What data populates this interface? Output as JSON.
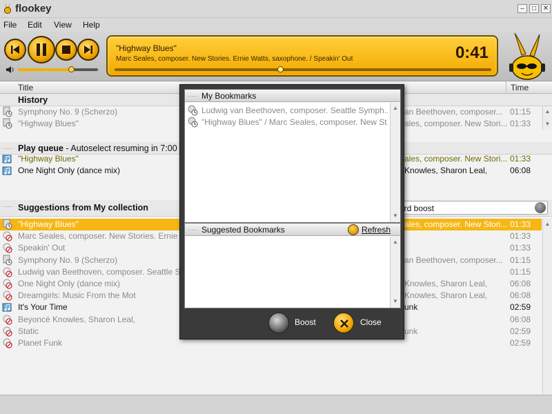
{
  "app": {
    "title": "flookey"
  },
  "menu": {
    "file": "File",
    "edit": "Edit",
    "view": "View",
    "help": "Help"
  },
  "player": {
    "now_title": "\"Highway Blues\"",
    "now_meta": "Marc Seales, composer. New Stories. Ernie Watts, saxophone. / Speakin' Out",
    "time": "0:41",
    "seek_fraction": 0.44,
    "volume_fraction": 0.66
  },
  "columns": {
    "title": "Title",
    "time": "Time"
  },
  "history": {
    "label": "History",
    "rows": [
      {
        "title": "Symphony No. 9 (Scherzo)",
        "artist": "an Beethoven, composer...",
        "time": "01:15"
      },
      {
        "title": "\"Highway Blues\"",
        "artist": "ales, composer. New Stori...",
        "time": "01:33"
      }
    ]
  },
  "queue": {
    "label": "Play queue",
    "sublabel": " - Autoselect resuming in 7:00",
    "rows": [
      {
        "title": "\"Highway Blues\"",
        "artist": "ales, composer. New Stori...",
        "time": "01:33"
      },
      {
        "title": "One Night Only (dance mix)",
        "artist": "Knowles, Sharon Leal,",
        "time": "06:08"
      }
    ]
  },
  "suggestions": {
    "label": "Suggestions from My collection",
    "search_value": "ord boost",
    "rows": [
      {
        "title": "\"Highway Blues\"",
        "artist": "ales, composer. New Stori...",
        "time": "01:33"
      },
      {
        "title": "Marc Seales, composer. New Stories. Ernie W",
        "artist": "",
        "time": "01:33"
      },
      {
        "title": "Speakin' Out",
        "artist": "",
        "time": "01:33"
      },
      {
        "title": "Symphony No. 9 (Scherzo)",
        "artist": "an Beethoven, composer...",
        "time": "01:15"
      },
      {
        "title": "Ludwig van Beethoven, composer. Seattle Sy",
        "artist": "",
        "time": "01:15"
      },
      {
        "title": "One Night Only (dance mix)",
        "artist": "Knowles, Sharon Leal,",
        "time": "06:08"
      },
      {
        "title": "Dreamgirls: Music From the Mot",
        "artist": "Knowles, Sharon Leal,",
        "time": "06:08"
      },
      {
        "title": "It's Your Time",
        "artist": "unk",
        "time": "02:59"
      },
      {
        "title": "Beyoncé Knowles, Sharon Leal,",
        "artist": "",
        "time": "06:08"
      },
      {
        "title": "Static",
        "artist": "unk",
        "time": "02:59"
      },
      {
        "title": "Planet Funk",
        "artist": "",
        "time": "02:59"
      }
    ]
  },
  "dialog": {
    "my_bookmarks": "My Bookmarks",
    "bookmarks": [
      "Ludwig van Beethoven, composer. Seattle Symph...",
      "\"Highway Blues\" / Marc Seales, composer. New St..."
    ],
    "suggested_bookmarks": "Suggested Bookmarks",
    "refresh": "Refresh",
    "boost": "Boost",
    "close": "Close"
  },
  "colors": {
    "accent": "#f6b714",
    "dialog_bg": "#3a3a3a"
  }
}
